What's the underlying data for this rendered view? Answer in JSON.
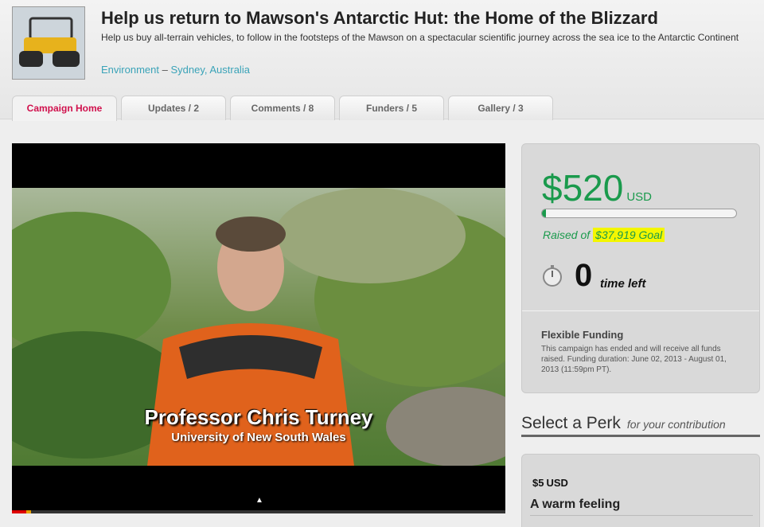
{
  "campaign": {
    "title": "Help us return to Mawson's Antarctic Hut: the Home of the Blizzard",
    "subtitle": "Help us buy all-terrain vehicles, to follow in the footsteps of the Mawson on a spectacular scientific journey across the sea ice to the Antarctic Continent",
    "category": "Environment",
    "separator": " – ",
    "location": "Sydney, Australia"
  },
  "tabs": [
    {
      "label": "Campaign Home",
      "active": true
    },
    {
      "label": "Updates / 2"
    },
    {
      "label": "Comments / 8"
    },
    {
      "label": "Funders / 5"
    },
    {
      "label": "Gallery / 3"
    }
  ],
  "video": {
    "caption_name": "Professor Chris Turney",
    "caption_affiliation": "University of New South Wales"
  },
  "funding": {
    "amount": "$520",
    "currency": "USD",
    "progress_fraction": 0.014,
    "raised_prefix": "Raised of ",
    "goal": "$37,919 Goal",
    "time_value": "0",
    "time_label": "time left",
    "type_title": "Flexible Funding",
    "type_description": "This campaign has ended and will receive all funds raised. Funding duration: June 02, 2013 - August 01, 2013 (11:59pm PT).",
    "accent_color": "#1a9a4c"
  },
  "perks": {
    "heading": "Select a Perk",
    "subheading": "for your contribution",
    "items": [
      {
        "amount": "$5",
        "currency": "USD",
        "name": "A warm feeling"
      }
    ]
  }
}
